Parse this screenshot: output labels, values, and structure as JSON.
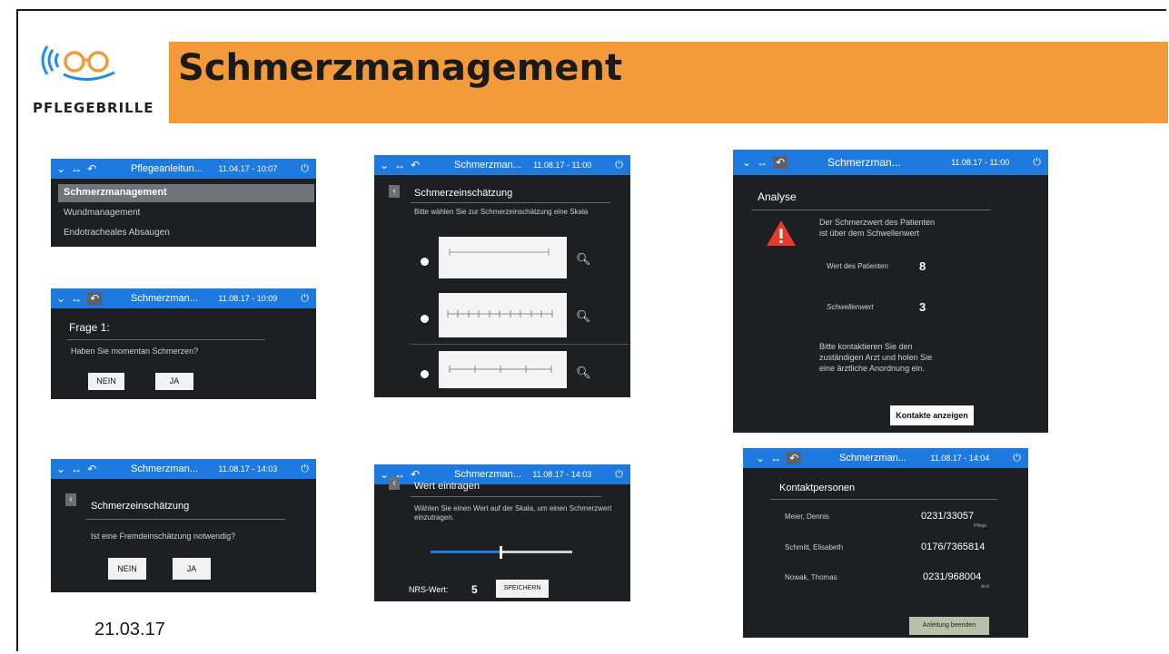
{
  "logo": {
    "text": "PFLEGEBRILLE"
  },
  "title": "Schmerzmanagement",
  "footer_date": "21.03.17",
  "colors": {
    "accent": "#1f7ae0",
    "title_bar": "#f39a3a",
    "screen_bg": "#1e1f22"
  },
  "screen1": {
    "title": "Pflegeanleitun...",
    "time": "11.04.17 - 10:07",
    "items": [
      "Schmerzmanagement",
      "Wundmanagement",
      "Endotracheales Absaugen"
    ]
  },
  "screen2": {
    "title": "Schmerzman...",
    "time": "11.08.17 - 10:09",
    "heading": "Frage 1:",
    "question": "Haben Sie momentan Schmerzen?",
    "btn_no": "NEIN",
    "btn_yes": "JA"
  },
  "screen3": {
    "title": "Schmerzman...",
    "time": "11.08.17 - 14:03",
    "heading": "Schmerzeinschätzung",
    "question": "Ist eine Fremdeinschätzung notwendig?",
    "btn_no": "NEIN",
    "btn_yes": "JA"
  },
  "screen4": {
    "title": "Schmerzman...",
    "time": "11.08.17 - 11:00",
    "heading": "Schmerzeinschätzung",
    "instruction": "Bitte wählen Sie zur Schmerzeinschätzung eine Skala"
  },
  "screen5": {
    "title": "Schmerzman...",
    "time": "11.08.17 - 14:03",
    "heading": "Wert eintragen",
    "instruction": "Wählen Sie einen Wert auf der Skala, um einen Schmerzwert einzutragen.",
    "nrs_label": "NRS-Wert:",
    "nrs_value": "5",
    "save_label": "SPEICHERN"
  },
  "screen6": {
    "title": "Schmerzman...",
    "time": "11.08.17 - 11:00",
    "heading": "Analyse",
    "alert_text_1": "Der Schmerzwert des Patienten",
    "alert_text_2": "ist über dem Schwellenwert",
    "patient_label": "Wert des Patienten",
    "patient_value": "8",
    "threshold_label": "Schwellenwert",
    "threshold_value": "3",
    "contact_text_1": "Bitte kontaktieren Sie den",
    "contact_text_2": "zuständigen Arzt und holen Sie",
    "contact_text_3": "eine ärztliche Anordnung ein.",
    "contacts_button": "Kontakte anzeigen"
  },
  "screen7": {
    "title": "Schmerzman...",
    "time": "11.08.17 - 14:04",
    "heading": "Kontaktpersonen",
    "contacts": [
      {
        "name": "Meier, Dennis",
        "phone": "0231/33057",
        "role": "Pflege"
      },
      {
        "name": "Schmitt, Elisabeth",
        "phone": "0176/7365814",
        "role": ""
      },
      {
        "name": "Nowak, Thomas",
        "phone": "0231/968004",
        "role": "Arzt"
      }
    ],
    "end_button": "Anleitung beenden"
  }
}
